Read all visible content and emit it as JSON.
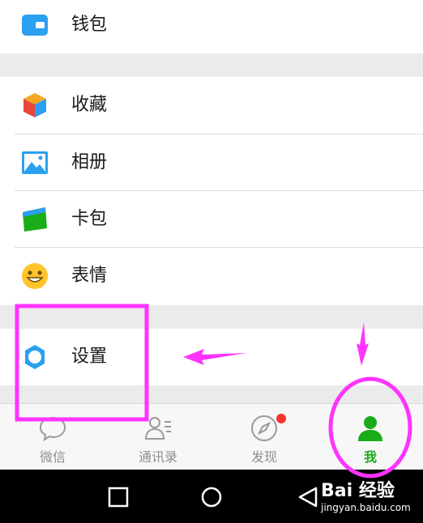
{
  "menu": {
    "wallet": "钱包",
    "favorites": "收藏",
    "album": "相册",
    "cards": "卡包",
    "stickers": "表情",
    "settings": "设置"
  },
  "tabs": {
    "chats": "微信",
    "contacts": "通讯录",
    "discover": "发现",
    "me": "我"
  },
  "watermark": {
    "brand": "Bai 经验",
    "url": "jingyan.baidu.com"
  },
  "colors": {
    "accent": "#1aad19",
    "annotation": "#ff33ff",
    "badge": "#f43530"
  }
}
